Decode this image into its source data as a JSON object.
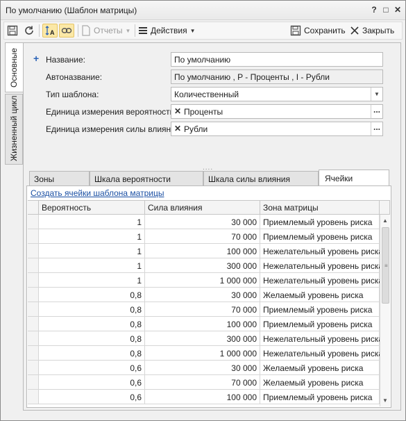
{
  "window": {
    "title": "По умолчанию (Шаблон матрицы)",
    "help_label": "?",
    "restore_label": "□",
    "close_label": "✕"
  },
  "toolbar": {
    "reports_label": "Отчеты",
    "actions_label": "Действия",
    "save_label": "Сохранить",
    "close_label": "Закрыть"
  },
  "side_tabs": [
    {
      "label": "Основные",
      "active": true
    },
    {
      "label": "Жизненный цикл",
      "active": false
    }
  ],
  "form": {
    "name": {
      "label": "Название:",
      "value": "По умолчанию"
    },
    "auto_name": {
      "label": "Автоназвание:",
      "value": "По умолчанию , P - Проценты , I - Рубли"
    },
    "template_type": {
      "label": "Тип шаблона:",
      "value": "Количественный"
    },
    "probability_unit": {
      "label": "Единица измерения вероятности:",
      "value": "Проценты"
    },
    "impact_unit": {
      "label": "Единица измерения силы влияния:",
      "value": "Рубли"
    }
  },
  "splitter_label": "....",
  "tabs": [
    {
      "label": "Зоны",
      "active": false
    },
    {
      "label": "Шкала вероятности",
      "active": false
    },
    {
      "label": "Шкала силы влияния",
      "active": false
    },
    {
      "label": "Ячейки",
      "active": true
    }
  ],
  "cells_tab": {
    "create_link": "Создать ячейки шаблона матрицы",
    "columns": [
      "Вероятность",
      "Сила влияния",
      "Зона матрицы"
    ],
    "rows": [
      [
        "1",
        "30 000",
        "Приемлемый уровень риска"
      ],
      [
        "1",
        "70 000",
        "Приемлемый уровень риска"
      ],
      [
        "1",
        "100 000",
        "Нежелательный уровень риска"
      ],
      [
        "1",
        "300 000",
        "Нежелательный уровень риска"
      ],
      [
        "1",
        "1 000 000",
        "Нежелательный уровень риска"
      ],
      [
        "0,8",
        "30 000",
        "Желаемый уровень риска"
      ],
      [
        "0,8",
        "70 000",
        "Приемлемый уровень риска"
      ],
      [
        "0,8",
        "100 000",
        "Приемлемый уровень риска"
      ],
      [
        "0,8",
        "300 000",
        "Нежелательный уровень риска"
      ],
      [
        "0,8",
        "1 000 000",
        "Нежелательный уровень риска"
      ],
      [
        "0,6",
        "30 000",
        "Желаемый уровень риска"
      ],
      [
        "0,6",
        "70 000",
        "Желаемый уровень риска"
      ],
      [
        "0,6",
        "100 000",
        "Приемлемый уровень риска"
      ]
    ]
  },
  "colors": {
    "accent": "#1a4fa3",
    "toggle_active": "#fbe8a6"
  }
}
